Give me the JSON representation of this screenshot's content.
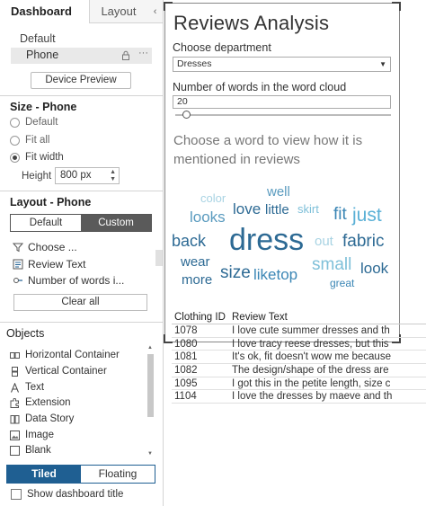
{
  "left_panel": {
    "tabs": {
      "dashboard": "Dashboard",
      "layout": "Layout",
      "collapse_glyph": "‹"
    },
    "device": {
      "default": "Default",
      "phone": "Phone",
      "more": "···",
      "preview_button": "Device Preview"
    },
    "size": {
      "title": "Size - Phone",
      "options": [
        "Default",
        "Fit all",
        "Fit width"
      ],
      "selected": "Fit width",
      "height_label": "Height",
      "height_value": "800 px"
    },
    "layout": {
      "title": "Layout - Phone",
      "segments": [
        "Default",
        "Custom"
      ],
      "selected_segment": "Custom",
      "items": [
        "Choose ...",
        "Review Text",
        "Number of words i..."
      ],
      "clear_all": "Clear all"
    },
    "objects": {
      "title": "Objects",
      "items": [
        {
          "label": "Horizontal Container",
          "icon": "horizontal-container-icon"
        },
        {
          "label": "Vertical Container",
          "icon": "vertical-container-icon"
        },
        {
          "label": "Text",
          "icon": "text-icon"
        },
        {
          "label": "Extension",
          "icon": "extension-icon"
        },
        {
          "label": "Data Story",
          "icon": "data-story-icon"
        },
        {
          "label": "Image",
          "icon": "image-icon"
        },
        {
          "label": "Blank",
          "icon": "blank-icon"
        }
      ],
      "tiled": "Tiled",
      "floating": "Floating",
      "show_title": "Show dashboard title"
    }
  },
  "dashboard": {
    "title": "Reviews Analysis",
    "dept_label": "Choose department",
    "dept_value": "Dresses",
    "words_label": "Number of words in the word cloud",
    "words_value": "20",
    "words_slider_fraction": 0.05,
    "prompt": "Choose a word to view how it is mentioned in reviews",
    "word_cloud": [
      {
        "text": "well",
        "color": "#5a9bbf"
      },
      {
        "text": "color",
        "color": "#a8d3e3"
      },
      {
        "text": "looks",
        "color": "#5a9bbf"
      },
      {
        "text": "love",
        "color": "#2d6a94"
      },
      {
        "text": "little",
        "color": "#2d6a94"
      },
      {
        "text": "skirt",
        "color": "#7fc0d9"
      },
      {
        "text": "fit",
        "color": "#3b86b5"
      },
      {
        "text": "just",
        "color": "#5ab0d6"
      },
      {
        "text": "back",
        "color": "#2d6a94"
      },
      {
        "text": "dress",
        "color": "#2d6a94"
      },
      {
        "text": "out",
        "color": "#a8d3e3"
      },
      {
        "text": "fabric",
        "color": "#2d6a94"
      },
      {
        "text": "wear",
        "color": "#2d6a94"
      },
      {
        "text": "size",
        "color": "#2d6a94"
      },
      {
        "text": "liketop",
        "color": "#3b86b5"
      },
      {
        "text": "small",
        "color": "#7fc0d9"
      },
      {
        "text": "look",
        "color": "#2d6a94"
      },
      {
        "text": "more",
        "color": "#2d6a94"
      },
      {
        "text": "great",
        "color": "#3b86b5"
      }
    ],
    "table": {
      "headers": [
        "Clothing ID",
        "Review Text"
      ],
      "rows": [
        [
          "1078",
          "I love cute summer dresses and th"
        ],
        [
          "1080",
          "I love tracy reese dresses, but this"
        ],
        [
          "1081",
          "It's ok, fit doesn't wow me because"
        ],
        [
          "1082",
          "The design/shape of the dress are"
        ],
        [
          "1095",
          "I got this in the petite length, size c"
        ],
        [
          "1104",
          "I love the dresses by maeve and th"
        ]
      ]
    }
  }
}
